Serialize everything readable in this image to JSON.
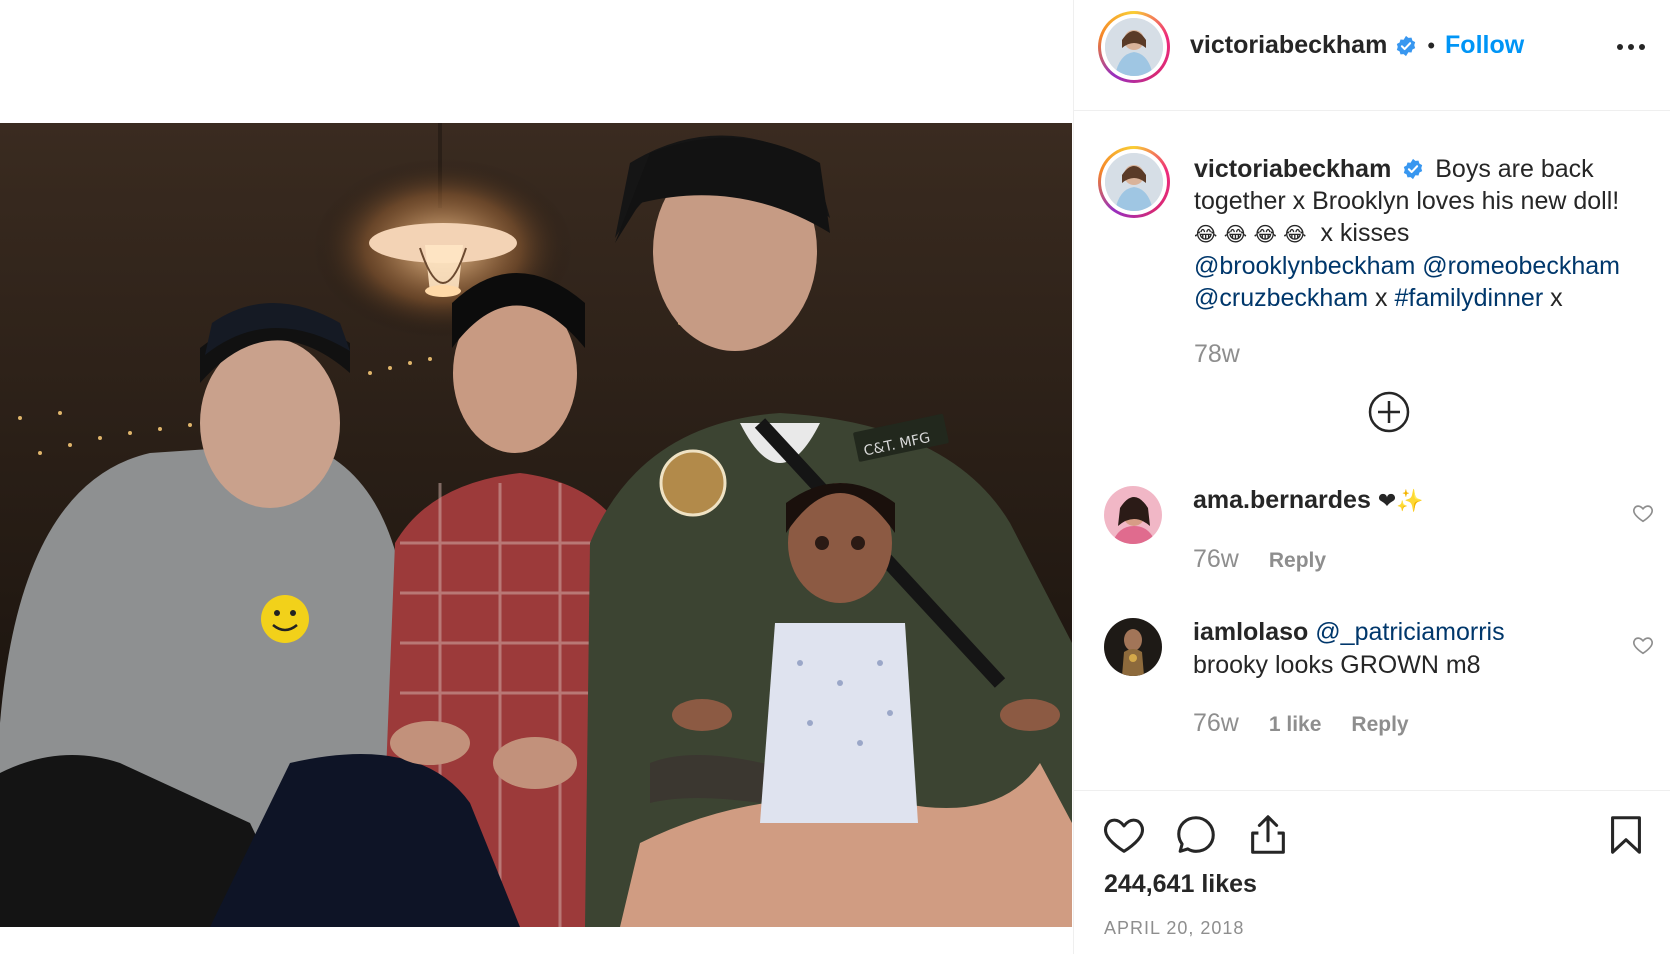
{
  "post": {
    "author": "victoriabeckham",
    "follow_label": "Follow",
    "dot": "•",
    "caption": {
      "username": "victoriabeckham",
      "line1": "Boys are back",
      "line2": "together x Brooklyn loves his new doll!",
      "emojis": "😂 😂 😂 😂",
      "line3": "x kisses",
      "mentions_1a": "@brooklynbeckham",
      "mentions_1b": "@romeobeckham",
      "mentions_2a": "@cruzbeckham",
      "sep_x": "x",
      "hashtag": "#familydinner",
      "end_x": "x",
      "age": "78w"
    },
    "comments": [
      {
        "username": "ama.bernardes",
        "text": "❤✨",
        "age": "76w",
        "reply": "Reply"
      },
      {
        "username": "iamlolaso",
        "mention": "@_patriciamorris",
        "text": "brooky looks GROWN m8",
        "age": "76w",
        "likes": "1 like",
        "reply": "Reply"
      }
    ],
    "likes": "244,641 likes",
    "date": "APRIL 20, 2018"
  },
  "icons": {
    "verified": "verified-badge-icon",
    "more": "more-options-icon",
    "load_more": "plus-circle-icon",
    "like": "heart-icon",
    "comment": "comment-bubble-icon",
    "share": "share-icon",
    "save": "bookmark-icon"
  },
  "colors": {
    "accent": "#0095f6",
    "verified": "#3897f0",
    "mention": "#00376b",
    "meta": "#8e8e8e",
    "text": "#262626"
  }
}
